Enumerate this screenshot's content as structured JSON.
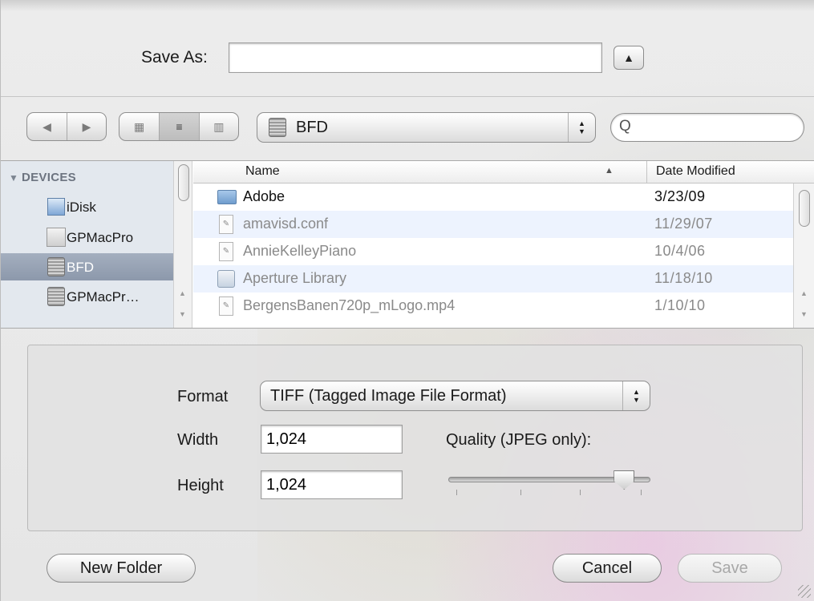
{
  "save_as": {
    "label": "Save As:",
    "value": "",
    "disclosure_icon": "triangle-up-icon"
  },
  "toolbar": {
    "back_icon": "◀",
    "forward_icon": "▶",
    "view_icon_grid": "▦",
    "view_icon_list": "≡",
    "view_icon_columns": "▥",
    "location": "BFD",
    "search_value": "",
    "search_icon": "Q"
  },
  "sidebar": {
    "header": "DEVICES",
    "items": [
      {
        "label": "iDisk",
        "icon": "idisk-icon",
        "selected": false
      },
      {
        "label": "GPMacPro",
        "icon": "hard-drive-icon",
        "selected": false
      },
      {
        "label": "BFD",
        "icon": "drive-icon",
        "selected": true
      },
      {
        "label": "GPMacPr…",
        "icon": "drive-icon",
        "selected": false
      }
    ]
  },
  "file_list": {
    "columns": {
      "name": "Name",
      "date": "Date Modified"
    },
    "rows": [
      {
        "name": "Adobe",
        "date": "3/23/09",
        "type": "folder",
        "enabled": true
      },
      {
        "name": "amavisd.conf",
        "date": "11/29/07",
        "type": "document",
        "enabled": false
      },
      {
        "name": "AnnieKelleyPiano",
        "date": "10/4/06",
        "type": "document",
        "enabled": false
      },
      {
        "name": "Aperture Library",
        "date": "11/18/10",
        "type": "library",
        "enabled": false
      },
      {
        "name": "BergensBanen720p_mLogo.mp4",
        "date": "1/10/10",
        "type": "document",
        "enabled": false
      }
    ]
  },
  "options": {
    "format_label": "Format",
    "format_value": "TIFF (Tagged Image File Format)",
    "width_label": "Width",
    "width_value": "1,024",
    "height_label": "Height",
    "height_value": "1,024",
    "quality_label": "Quality (JPEG only):",
    "quality_level": 0.87
  },
  "buttons": {
    "new_folder": "New Folder",
    "cancel": "Cancel",
    "save": "Save"
  }
}
